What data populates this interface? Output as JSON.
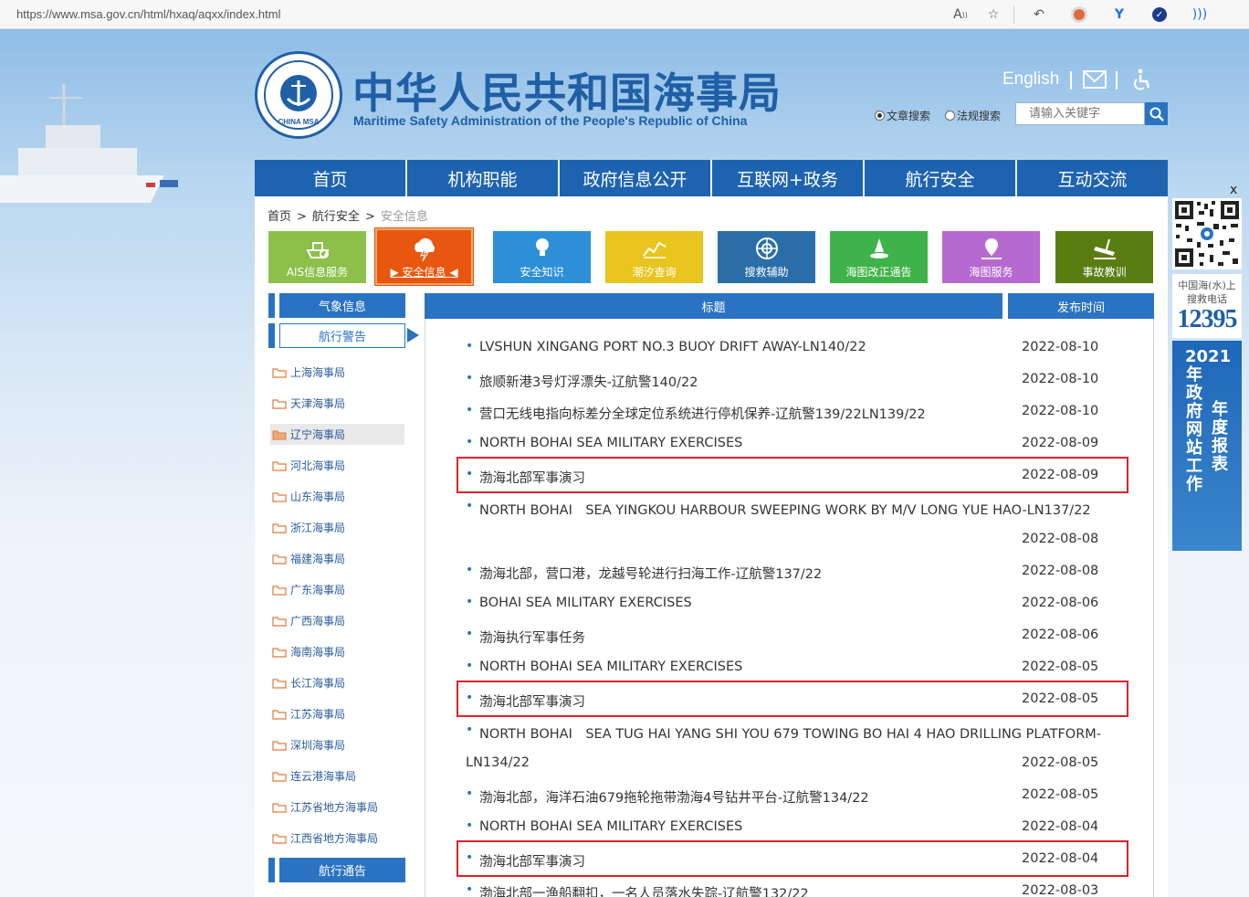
{
  "browser": {
    "url": "https://www.msa.gov.cn/html/hxaq/aqxx/index.html",
    "icons": [
      "read-aloud-icon",
      "favorite-icon",
      "back-icon",
      "record-icon",
      "extension-icon",
      "check-icon",
      "wifi-icon"
    ]
  },
  "header": {
    "title_cn": "中华人民共和国海事局",
    "title_en": "Maritime Safety Administration of the People's Republic of China",
    "logo_text": "CHINA MSA",
    "english_link": "English",
    "search": {
      "option_article": "文章搜索",
      "option_law": "法规搜索",
      "selected": "文章搜索",
      "placeholder": "请输入关键字"
    }
  },
  "nav": [
    "首页",
    "机构职能",
    "政府信息公开",
    "互联网+政务",
    "航行安全",
    "互动交流"
  ],
  "breadcrumb": [
    "首页",
    "航行安全",
    "安全信息"
  ],
  "tiles": [
    {
      "label": "AIS信息服务",
      "color": "#8dc04b",
      "icon": "ship-icon"
    },
    {
      "label": "安全信息",
      "color": "#e8570f",
      "icon": "cloud-lightning-icon",
      "active": true
    },
    {
      "label": "安全知识",
      "color": "#2d8fd8",
      "icon": "lightbulb-icon"
    },
    {
      "label": "潮汐查询",
      "color": "#e8c51f",
      "icon": "tide-chart-icon"
    },
    {
      "label": "搜救辅助",
      "color": "#2a6ea9",
      "icon": "lifebuoy-icon"
    },
    {
      "label": "海图改正通告",
      "color": "#3fb34a",
      "icon": "buoy-icon"
    },
    {
      "label": "海图服务",
      "color": "#b66ad0",
      "icon": "map-pin-icon"
    },
    {
      "label": "事故教训",
      "color": "#5a7d12",
      "icon": "wreck-icon"
    }
  ],
  "sidebar": {
    "weather": "气象信息",
    "warning": "航行警告",
    "items": [
      "上海海事局",
      "天津海事局",
      "辽宁海事局",
      "河北海事局",
      "山东海事局",
      "浙江海事局",
      "福建海事局",
      "广东海事局",
      "广西海事局",
      "海南海事局",
      "长江海事局",
      "江苏海事局",
      "深圳海事局",
      "连云港海事局",
      "江苏省地方海事局",
      "江西省地方海事局"
    ],
    "selected": "辽宁海事局",
    "notice": "航行通告"
  },
  "table": {
    "col_title": "标题",
    "col_date": "发布时间",
    "rows": [
      {
        "title": "LVSHUN XINGANG PORT NO.3 BUOY DRIFT AWAY-LN140/22",
        "date": "2022-08-10"
      },
      {
        "title": "旅顺新港3号灯浮漂失-辽航警140/22",
        "date": "2022-08-10"
      },
      {
        "title": "营口无线电指向标差分全球定位系统进行停机保养-辽航警139/22LN139/22",
        "date": "2022-08-10"
      },
      {
        "title": "NORTH BOHAI SEA MILITARY EXERCISES",
        "date": "2022-08-09"
      },
      {
        "title": "渤海北部军事演习",
        "date": "2022-08-09",
        "highlight": true
      },
      {
        "title": "NORTH BOHAI　SEA YINGKOU HARBOUR SWEEPING WORK BY M/V LONG YUE HAO-LN137/22",
        "date": "2022-08-08"
      },
      {
        "title": "渤海北部，营口港，龙越号轮进行扫海工作-辽航警137/22",
        "date": "2022-08-08"
      },
      {
        "title": "BOHAI SEA MILITARY EXERCISES",
        "date": "2022-08-06"
      },
      {
        "title": "渤海执行军事任务",
        "date": "2022-08-06"
      },
      {
        "title": "NORTH BOHAI SEA MILITARY EXERCISES",
        "date": "2022-08-05"
      },
      {
        "title": "渤海北部军事演习",
        "date": "2022-08-05",
        "highlight": true
      },
      {
        "title": "NORTH BOHAI　SEA TUG HAI YANG SHI YOU 679 TOWING BO HAI 4 HAO DRILLING PLATFORM-",
        "title_cont": "LN134/22",
        "date": "2022-08-05"
      },
      {
        "title": "渤海北部，海洋石油679拖轮拖带渤海4号钻井平台-辽航警134/22",
        "date": "2022-08-05"
      },
      {
        "title": "NORTH BOHAI SEA MILITARY EXERCISES",
        "date": "2022-08-04"
      },
      {
        "title": "渤海北部军事演习",
        "date": "2022-08-04",
        "highlight": true
      },
      {
        "title": "渤海北部一渔船翻扣，一名人员落水失踪-辽航警132/22",
        "date": "2022-08-03"
      }
    ]
  },
  "right_float": {
    "close": "x",
    "hotline_label_1": "中国海(水)上",
    "hotline_label_2": "搜救电话",
    "hotline_number": "12395",
    "report_col_1": "2021年政府网站工作",
    "report_col_2": "年度报表"
  }
}
